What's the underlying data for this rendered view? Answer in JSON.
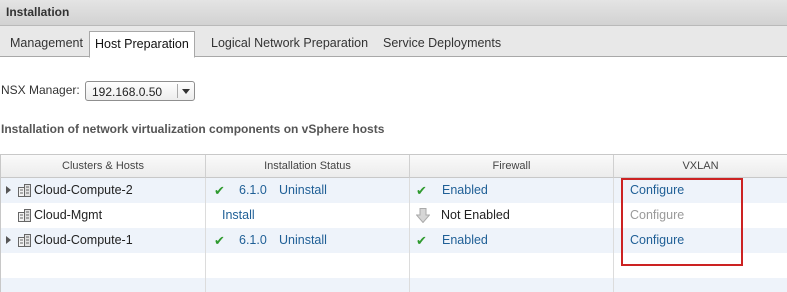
{
  "window": {
    "title": "Installation"
  },
  "tabs": [
    {
      "label": "Management"
    },
    {
      "label": "Host Preparation"
    },
    {
      "label": "Logical Network Preparation"
    },
    {
      "label": "Service Deployments"
    }
  ],
  "nsx_manager": {
    "label": "NSX Manager:",
    "selected": "192.168.0.50"
  },
  "section": {
    "title": "Installation of network virtualization components on vSphere hosts"
  },
  "table": {
    "columns": [
      "Clusters & Hosts",
      "Installation Status",
      "Firewall",
      "VXLAN"
    ],
    "rows": [
      {
        "name": "Cloud-Compute-2",
        "version": "6.1.0",
        "install_action": "Uninstall",
        "firewall": "Enabled",
        "vxlan": "Configure"
      },
      {
        "name": "Cloud-Mgmt",
        "version": "",
        "install_action": "Install",
        "firewall": "Not Enabled",
        "vxlan": "Configure"
      },
      {
        "name": "Cloud-Compute-1",
        "version": "6.1.0",
        "install_action": "Uninstall",
        "firewall": "Enabled",
        "vxlan": "Configure"
      }
    ]
  },
  "colors": {
    "link": "#1f5f96",
    "check": "#2e9a2e",
    "highlight": "#cc2222",
    "row_alt": "#eef3fa"
  },
  "icons": [
    "expand-arrow-icon",
    "cluster-icon",
    "check-icon",
    "not-enabled-arrow-icon",
    "dropdown-arrow-icon"
  ]
}
